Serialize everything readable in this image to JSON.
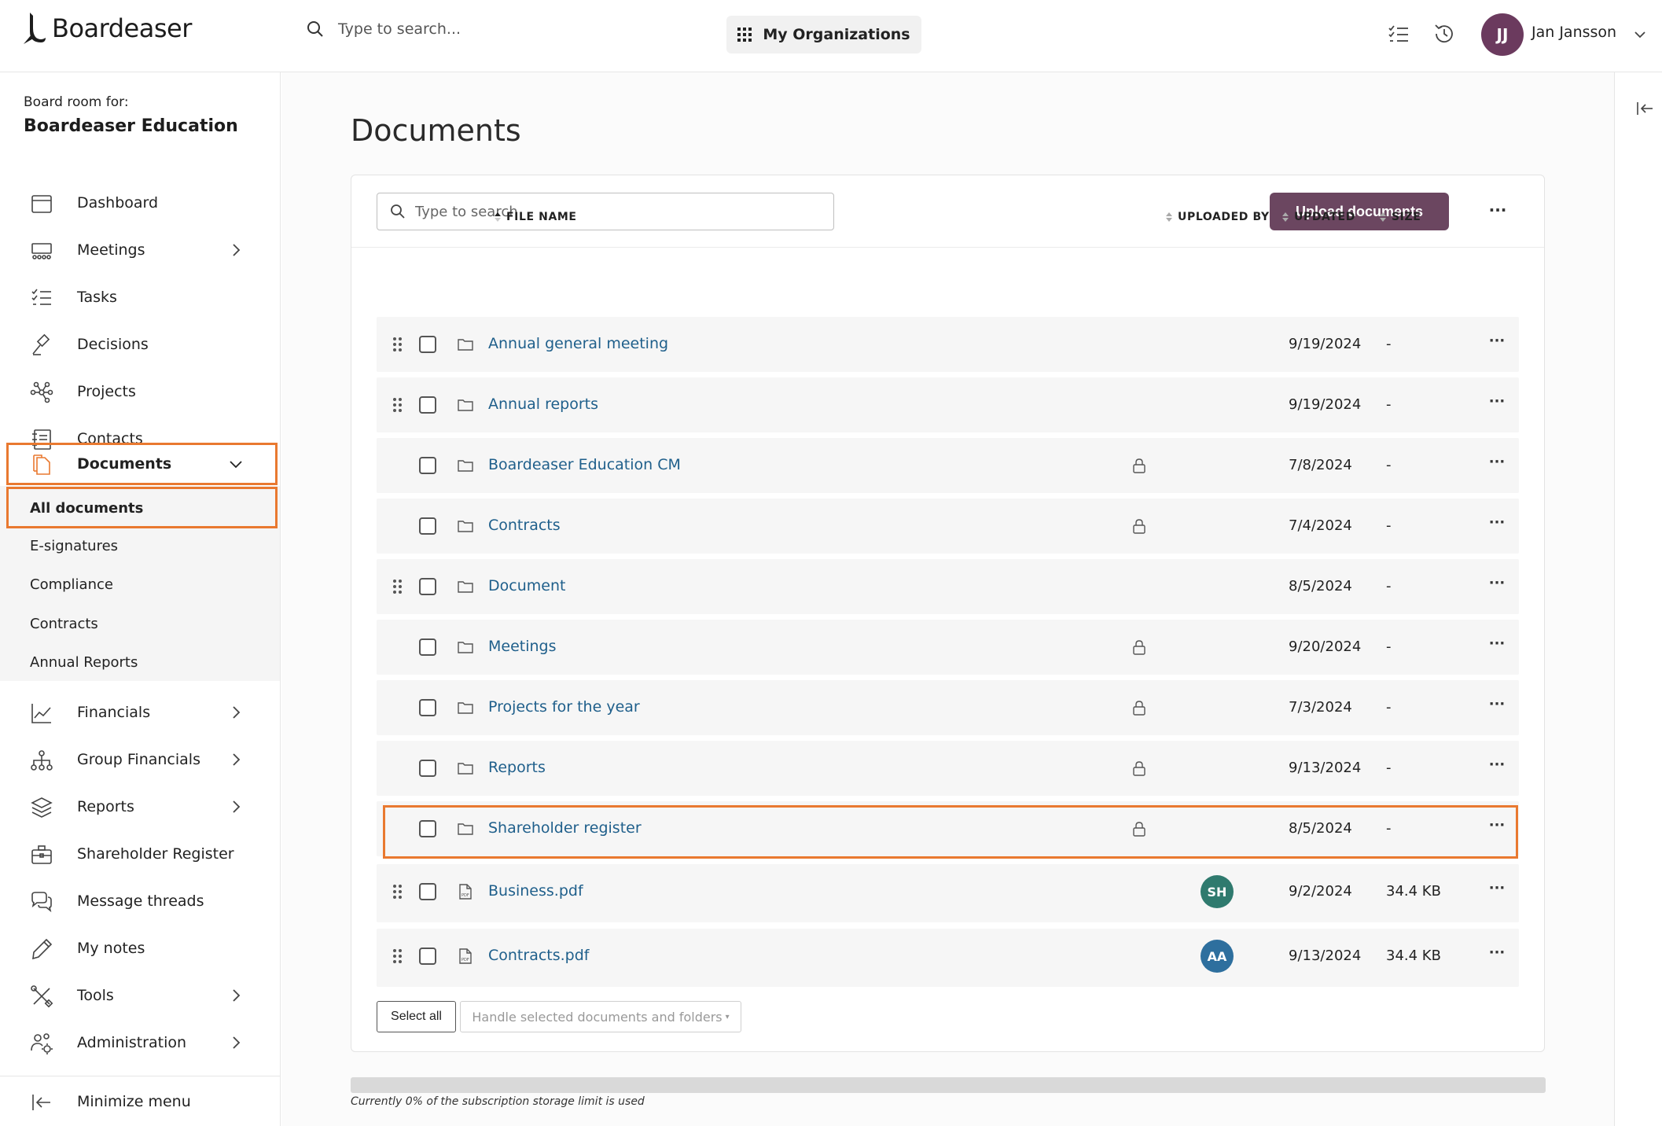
{
  "app": {
    "name": "Boardeaser"
  },
  "topbar": {
    "search_placeholder": "Type to search...",
    "org_button": "My Organizations",
    "user_initials": "JJ",
    "user_name": "Jan Jansson"
  },
  "sidebar": {
    "room_label": "Board room for:",
    "room_name": "Boardeaser Education",
    "items": [
      {
        "label": "Dashboard",
        "icon": "calendar-icon"
      },
      {
        "label": "Meetings",
        "icon": "meeting-icon"
      },
      {
        "label": "Tasks",
        "icon": "tasks-icon"
      },
      {
        "label": "Decisions",
        "icon": "gavel-icon"
      },
      {
        "label": "Projects",
        "icon": "network-icon"
      },
      {
        "label": "Contacts",
        "icon": "contacts-book-icon"
      },
      {
        "label": "Documents",
        "icon": "documents-icon"
      }
    ],
    "sub_items": [
      "All documents",
      "E-signatures",
      "Compliance",
      "Contracts",
      "Annual Reports"
    ],
    "items_after": [
      {
        "label": "Financials",
        "icon": "line-chart-icon"
      },
      {
        "label": "Group Financials",
        "icon": "org-chart-icon"
      },
      {
        "label": "Reports",
        "icon": "layers-icon"
      },
      {
        "label": "Shareholder Register",
        "icon": "briefcase-icon"
      },
      {
        "label": "Message threads",
        "icon": "chat-bubbles-icon"
      },
      {
        "label": "My notes",
        "icon": "pencil-icon"
      },
      {
        "label": "Tools",
        "icon": "tools-icon"
      },
      {
        "label": "Administration",
        "icon": "users-gear-icon"
      }
    ],
    "minimize": "Minimize menu"
  },
  "main": {
    "title": "Documents",
    "search_placeholder": "Type to search",
    "upload_button": "Upload documents",
    "more_label": "···",
    "columns": {
      "file_name": "FILE NAME",
      "uploaded_by": "UPLOADED BY",
      "updated": "UPDATED",
      "size": "SIZE"
    },
    "rows": [
      {
        "name": "Annual general meeting",
        "type": "folder",
        "draggable": true,
        "locked": false,
        "uploader": "",
        "updated": "9/19/2024",
        "size": "-"
      },
      {
        "name": "Annual reports",
        "type": "folder",
        "draggable": true,
        "locked": false,
        "uploader": "",
        "updated": "9/19/2024",
        "size": "-"
      },
      {
        "name": "Boardeaser Education CM",
        "type": "folder",
        "draggable": false,
        "locked": true,
        "uploader": "",
        "updated": "7/8/2024",
        "size": "-"
      },
      {
        "name": "Contracts",
        "type": "folder",
        "draggable": false,
        "locked": true,
        "uploader": "",
        "updated": "7/4/2024",
        "size": "-"
      },
      {
        "name": "Document",
        "type": "folder",
        "draggable": true,
        "locked": false,
        "uploader": "",
        "updated": "8/5/2024",
        "size": "-"
      },
      {
        "name": "Meetings",
        "type": "folder",
        "draggable": false,
        "locked": true,
        "uploader": "",
        "updated": "9/20/2024",
        "size": "-"
      },
      {
        "name": "Projects for the year",
        "type": "folder",
        "draggable": false,
        "locked": true,
        "uploader": "",
        "updated": "7/3/2024",
        "size": "-"
      },
      {
        "name": "Reports",
        "type": "folder",
        "draggable": false,
        "locked": true,
        "uploader": "",
        "updated": "9/13/2024",
        "size": "-"
      },
      {
        "name": "Shareholder register",
        "type": "folder",
        "draggable": false,
        "locked": true,
        "uploader": "",
        "updated": "8/5/2024",
        "size": "-"
      },
      {
        "name": "Business.pdf",
        "type": "pdf",
        "draggable": true,
        "locked": false,
        "uploader": "SH",
        "uploader_color": "#2f7a6e",
        "updated": "9/2/2024",
        "size": "34.4 KB"
      },
      {
        "name": "Contracts.pdf",
        "type": "pdf",
        "draggable": true,
        "locked": false,
        "uploader": "AA",
        "uploader_color": "#2e6f9e",
        "updated": "9/13/2024",
        "size": "34.4 KB"
      }
    ],
    "select_all": "Select all",
    "handle_selected": "Handle selected documents and folders",
    "storage_percent": 0,
    "storage_text": "Currently 0% of the subscription storage limit is used"
  },
  "colors": {
    "accent": "#6b4660",
    "highlight": "#e97930",
    "link": "#1f5f8b"
  }
}
